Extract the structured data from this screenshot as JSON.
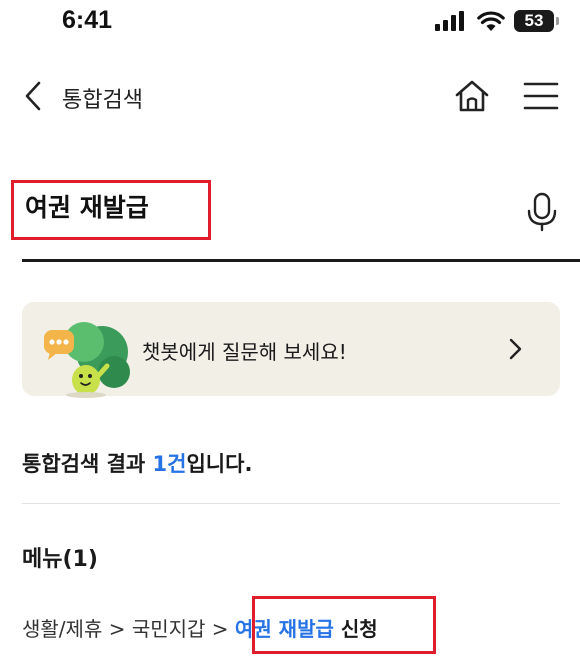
{
  "status_bar": {
    "time": "6:41",
    "battery": "53"
  },
  "nav": {
    "title": "통합검색"
  },
  "search": {
    "value": "여권 재발급"
  },
  "chatbot": {
    "text": "챗봇에게 질문해 보세요!"
  },
  "results": {
    "prefix": "통합검색 결과 ",
    "count": "1건",
    "suffix": "입니다."
  },
  "menu_section": {
    "heading": "메뉴(1)"
  },
  "breadcrumb": {
    "part1": "생활/제휴",
    "sep1": " > ",
    "part2": "국민지갑",
    "sep2": " > ",
    "link_highlight": "여권 재발급",
    "link_rest": " 신청"
  },
  "colors": {
    "accent_blue": "#2673e6",
    "annotation_red": "#e01e2b",
    "banner_bg": "#f1efe6"
  }
}
